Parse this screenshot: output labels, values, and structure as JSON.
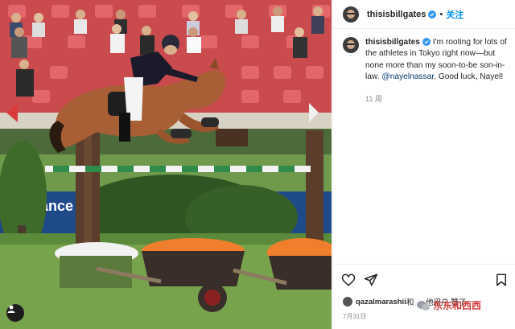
{
  "post": {
    "username": "thisisbillgates",
    "follow_label": "关注",
    "separator": "•",
    "caption_username": "thisisbillgates",
    "caption_before": " I'm rooting for lots of the athletes in Tokyo right now—but none more than my soon-to-be son-in-law. ",
    "caption_mention": "@nayelnassar",
    "caption_after": ". Good luck, Nayel!",
    "time_ago": "11 周",
    "likes_text": "qazalmarashii",
    "likes_suffix": " 和 … 他用户 赞了",
    "date": "7月31日"
  },
  "photo": {
    "banner_text": "ance"
  },
  "watermark": {
    "text": "东东和西西"
  },
  "icons": {
    "like": "heart-icon",
    "share": "paper-plane-icon",
    "save": "bookmark-icon",
    "user_tag": "person-icon",
    "verified": "verified-badge-icon"
  },
  "colors": {
    "accent": "#0095f6",
    "verified": "#3897f0",
    "mention": "#00376b",
    "watermark": "#d03a3a"
  }
}
